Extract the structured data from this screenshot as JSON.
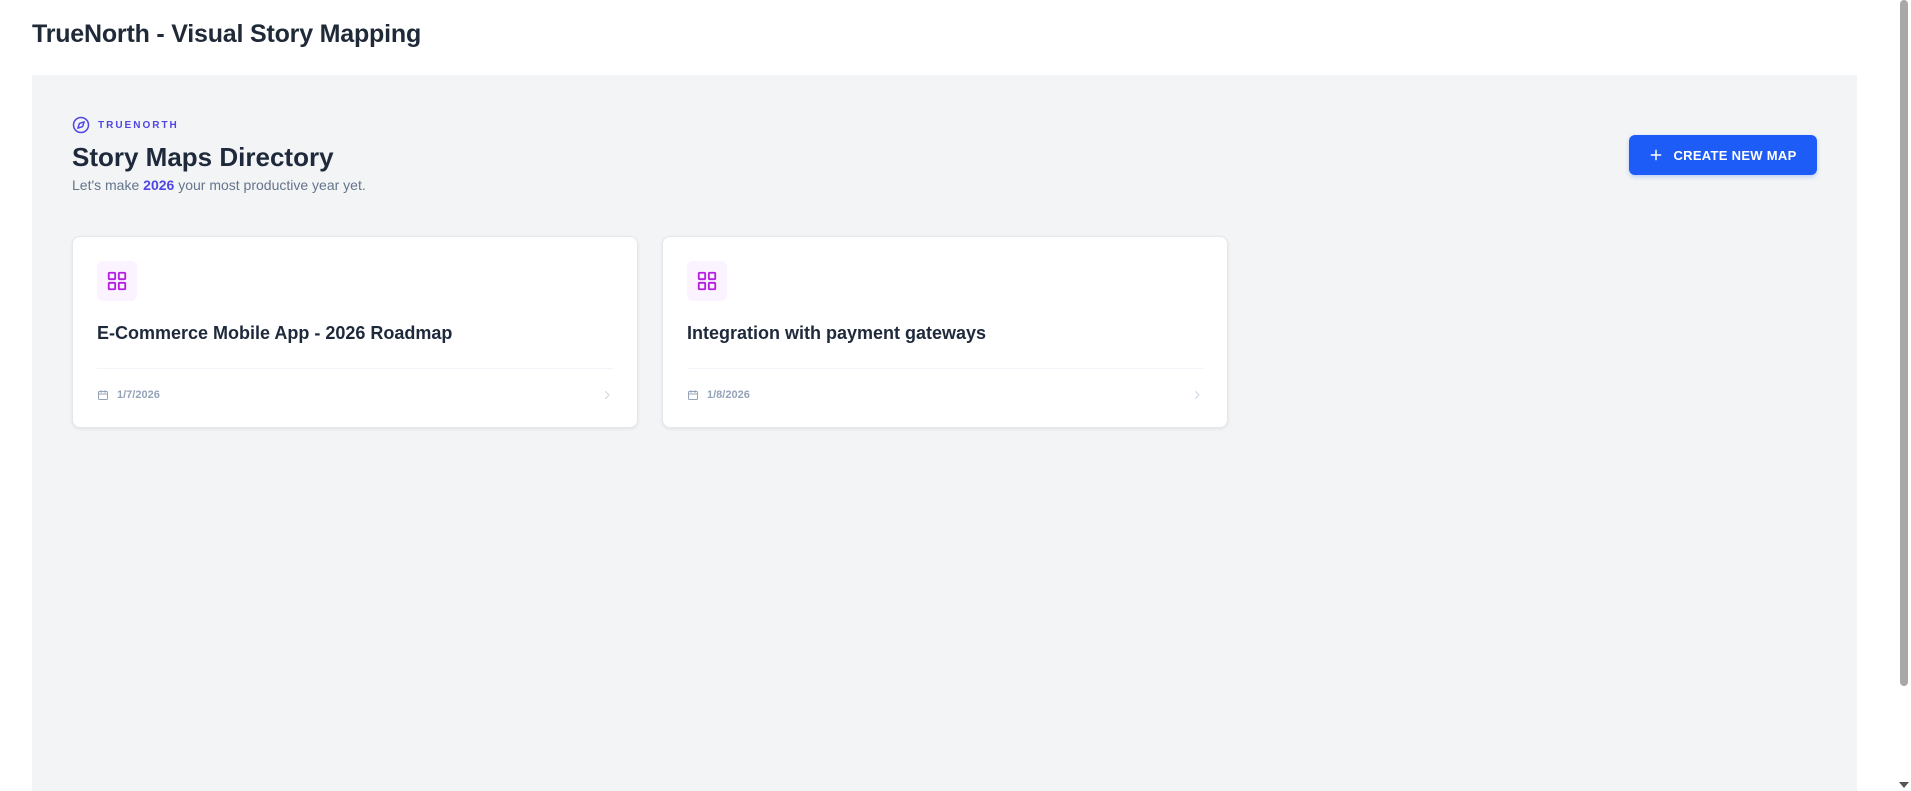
{
  "app": {
    "title": "TrueNorth - Visual Story Mapping"
  },
  "header": {
    "brand_name": "TRUENORTH",
    "brand_icon": "compass-icon",
    "title": "Story Maps Directory",
    "tagline_prefix": "Let's make ",
    "tagline_year": "2026",
    "tagline_suffix": " your most productive year yet."
  },
  "toolbar": {
    "create_label": "CREATE NEW MAP",
    "create_icon": "plus-icon"
  },
  "maps": [
    {
      "title": "E-Commerce Mobile App - 2026 Roadmap",
      "date": "1/7/2026",
      "icon": "grid-icon"
    },
    {
      "title": "Integration with payment gateways",
      "date": "1/8/2026",
      "icon": "grid-icon"
    }
  ],
  "colors": {
    "accent": "#1d5cf6",
    "brand": "#4f46e5",
    "card_icon": "#b51ee0",
    "panel_background": "#f3f4f6"
  }
}
